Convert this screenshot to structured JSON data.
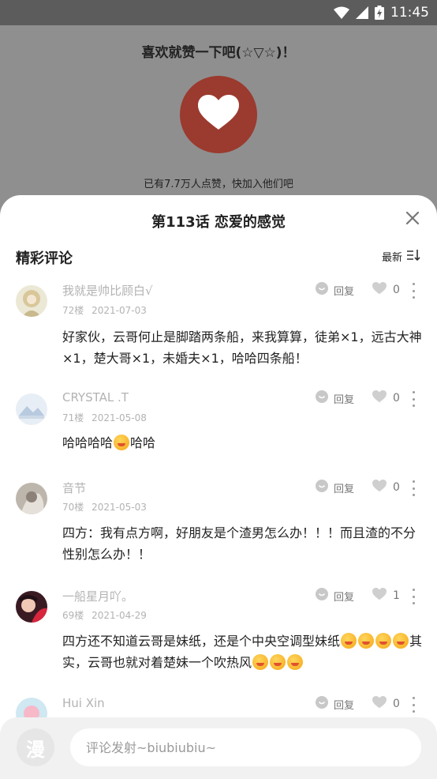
{
  "status_bar": {
    "time": "11:45"
  },
  "like_panel": {
    "prompt": "喜欢就赞一下吧(☆▽☆)！",
    "count_text": "已有7.7万人点赞，快加入他们吧"
  },
  "sheet": {
    "title": "第113话 恋爱的感觉",
    "section_title": "精彩评论",
    "sort_label": "最新"
  },
  "comments": [
    {
      "user": "我就是帅比顾白√",
      "floor": "72楼",
      "date": "2021-07-03",
      "reply_label": "回复",
      "likes": "0",
      "content": "好家伙，云哥何止是脚踏两条船，来我算算，徒弟×1，远古大神×1，楚大哥×1，未婚夫×1，哈哈四条船！"
    },
    {
      "user": "CRYSTAL .T",
      "floor": "71楼",
      "date": "2021-05-08",
      "reply_label": "回复",
      "likes": "0",
      "content_a": "哈哈哈哈",
      "content_b": "哈哈"
    },
    {
      "user": "音节",
      "floor": "70楼",
      "date": "2021-05-03",
      "reply_label": "回复",
      "likes": "0",
      "content": "四方：我有点方啊，好朋友是个渣男怎么办！！！而且渣的不分性别怎么办！！"
    },
    {
      "user": "一船星月吖。",
      "floor": "69楼",
      "date": "2021-04-29",
      "reply_label": "回复",
      "likes": "1",
      "content_a": "四方还不知道云哥是妹纸，还是个中央空调型妹纸",
      "content_b": "其实，云哥也就对着楚妹一个吹热风"
    },
    {
      "user": "Hui Xin",
      "reply_label": "回复",
      "likes": "0"
    }
  ],
  "input": {
    "placeholder": "评论发射~biubiubiu~",
    "logo_char": "漫"
  },
  "colors": {
    "like_button": "#9b3a2e",
    "overlay": "#8f8f8f",
    "meta_text": "#b3b3b3"
  }
}
